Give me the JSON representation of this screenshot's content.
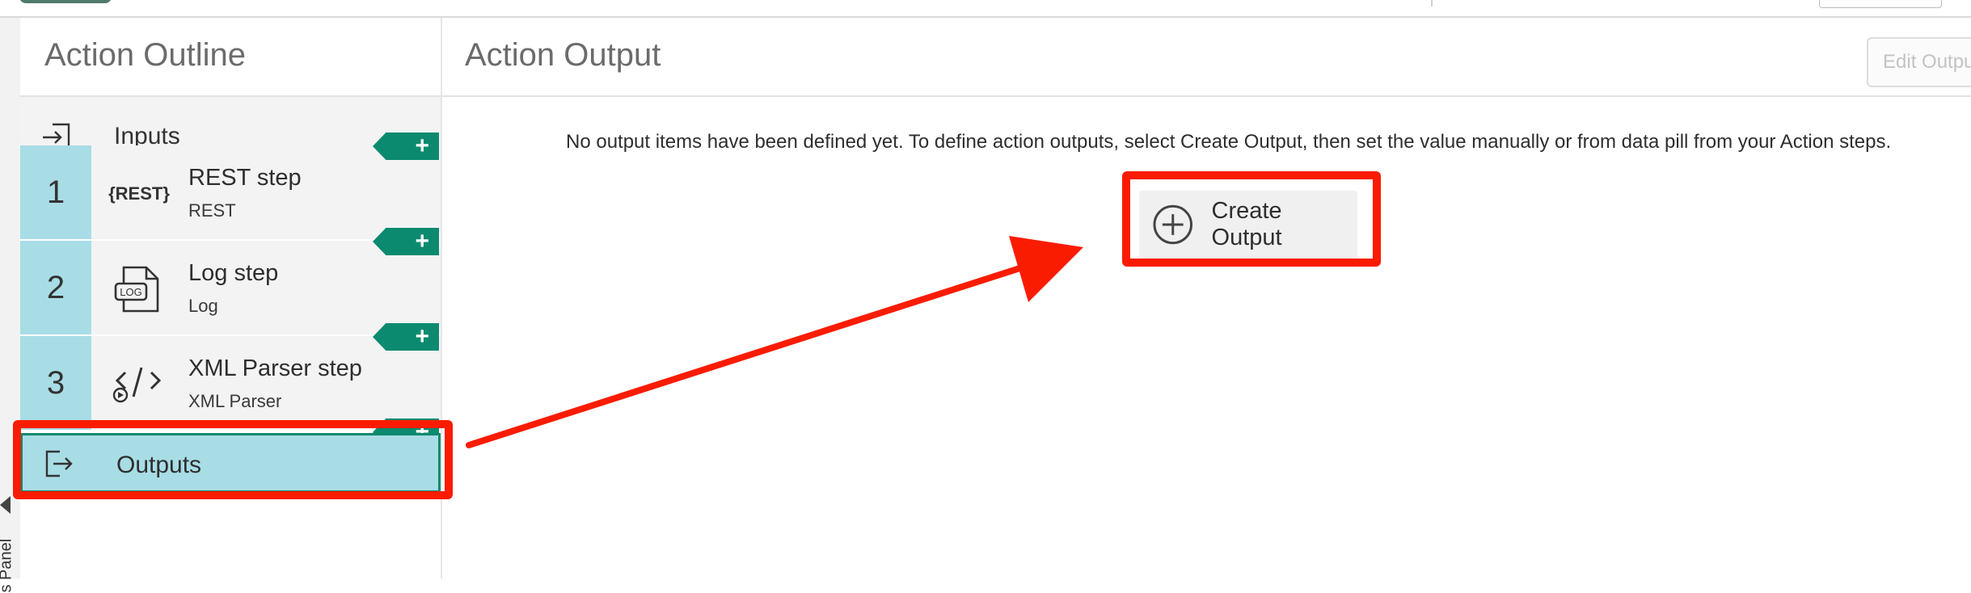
{
  "outline": {
    "title": "Action Outline",
    "inputs_label": "Inputs",
    "steps": [
      {
        "number": "1",
        "title": "REST step",
        "subtitle": "REST",
        "icon": "rest-icon"
      },
      {
        "number": "2",
        "title": "Log step",
        "subtitle": "Log",
        "icon": "log-icon"
      },
      {
        "number": "3",
        "title": "XML Parser step",
        "subtitle": "XML Parser",
        "icon": "xml-parser-icon"
      }
    ],
    "outputs_label": "Outputs",
    "add_label": "+",
    "rest_icon_text": "{REST}",
    "log_icon_text": "LOG"
  },
  "main": {
    "title": "Action Output",
    "edit_button": "Edit Outpu",
    "empty_message": "No output items have been defined yet. To define action outputs, select Create Output, then set the value manually or from data pill from your Action steps.",
    "create_button": "Create Output"
  },
  "side_panel_label": "s Panel",
  "colors": {
    "accent_green": "#0b8a6f",
    "step_number_bg": "#a8dde6",
    "annotation_red": "#fa1c00"
  }
}
